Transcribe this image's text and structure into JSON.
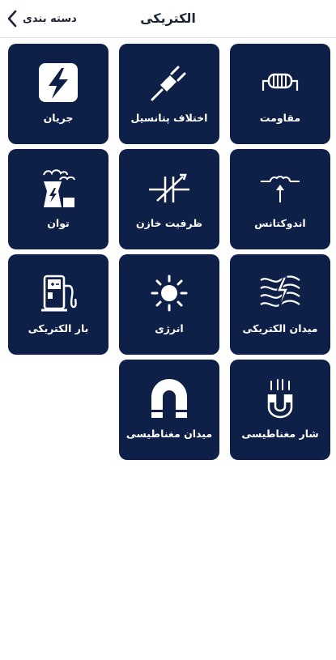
{
  "header": {
    "title": "الکتریکی",
    "back_label": "دسته بندی"
  },
  "tiles": [
    {
      "label": "مقاومت",
      "icon": "resistor-icon"
    },
    {
      "label": "اختلاف پتانسیل",
      "icon": "plug-icon"
    },
    {
      "label": "جریان",
      "icon": "lightning-icon"
    },
    {
      "label": "اندوکتانس",
      "icon": "inductor-icon"
    },
    {
      "label": "ظرفیت خازن",
      "icon": "variable-capacitor-icon"
    },
    {
      "label": "توان",
      "icon": "power-plant-icon"
    },
    {
      "label": "میدان الکتریکی",
      "icon": "electric-field-icon"
    },
    {
      "label": "انرژی",
      "icon": "sun-icon"
    },
    {
      "label": "بار الکتریکی",
      "icon": "charging-station-icon"
    },
    {
      "label": "شار مغناطیسی",
      "icon": "magnetic-flux-icon"
    },
    {
      "label": "میدان مغناطیسی",
      "icon": "magnet-icon"
    }
  ],
  "colors": {
    "tile_background": "#0f2048",
    "tile_text": "#ffffff",
    "header_text": "#1c2333"
  }
}
